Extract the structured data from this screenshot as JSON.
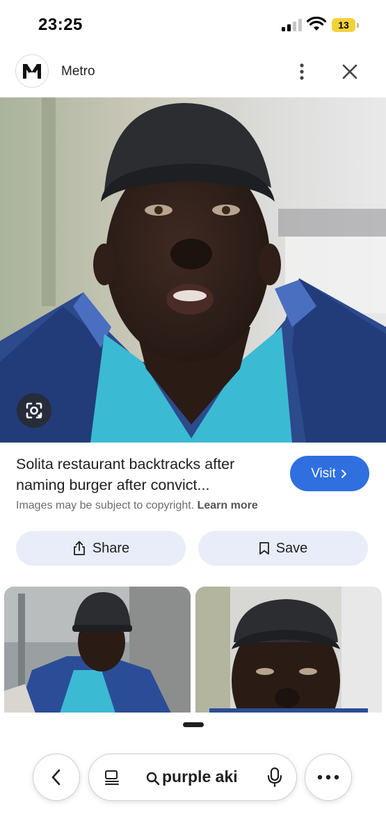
{
  "status_bar": {
    "time": "23:25",
    "battery": "13"
  },
  "header": {
    "source_name": "Metro",
    "logo_icon": "metro-logo"
  },
  "result": {
    "title": "Solita restaurant backtracks after naming burger after convict...",
    "visit_label": "Visit",
    "copyright_text": "Images may be subject to copyright.",
    "learn_more_label": "Learn more"
  },
  "actions": {
    "share_label": "Share",
    "save_label": "Save"
  },
  "bottom_bar": {
    "search_query": "purple aki"
  },
  "colors": {
    "accent": "#2f6fdf",
    "pill_bg": "#e8edf9",
    "battery": "#f2d23a"
  }
}
